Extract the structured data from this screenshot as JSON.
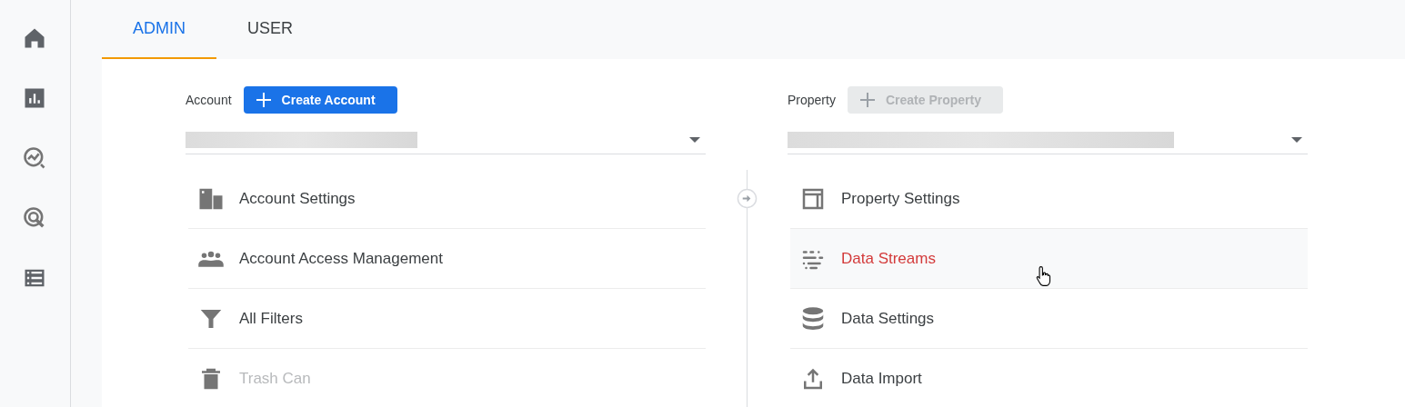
{
  "tabs": [
    {
      "label": "ADMIN",
      "selected": true
    },
    {
      "label": "USER",
      "selected": false
    }
  ],
  "columns": [
    {
      "label": "Account",
      "button": {
        "label": "Create Account",
        "disabled": false
      },
      "items": [
        {
          "label": "Account Settings",
          "disabled": false,
          "highlighted": false
        },
        {
          "label": "Account Access Management",
          "disabled": false,
          "highlighted": false
        },
        {
          "label": "All Filters",
          "disabled": false,
          "highlighted": false
        },
        {
          "label": "Trash Can",
          "disabled": true,
          "highlighted": false
        }
      ]
    },
    {
      "label": "Property",
      "button": {
        "label": "Create Property",
        "disabled": true
      },
      "items": [
        {
          "label": "Property Settings",
          "disabled": false,
          "highlighted": false
        },
        {
          "label": "Data Streams",
          "disabled": false,
          "highlighted": true
        },
        {
          "label": "Data Settings",
          "disabled": false,
          "highlighted": false
        },
        {
          "label": "Data Import",
          "disabled": false,
          "highlighted": false
        }
      ]
    }
  ]
}
